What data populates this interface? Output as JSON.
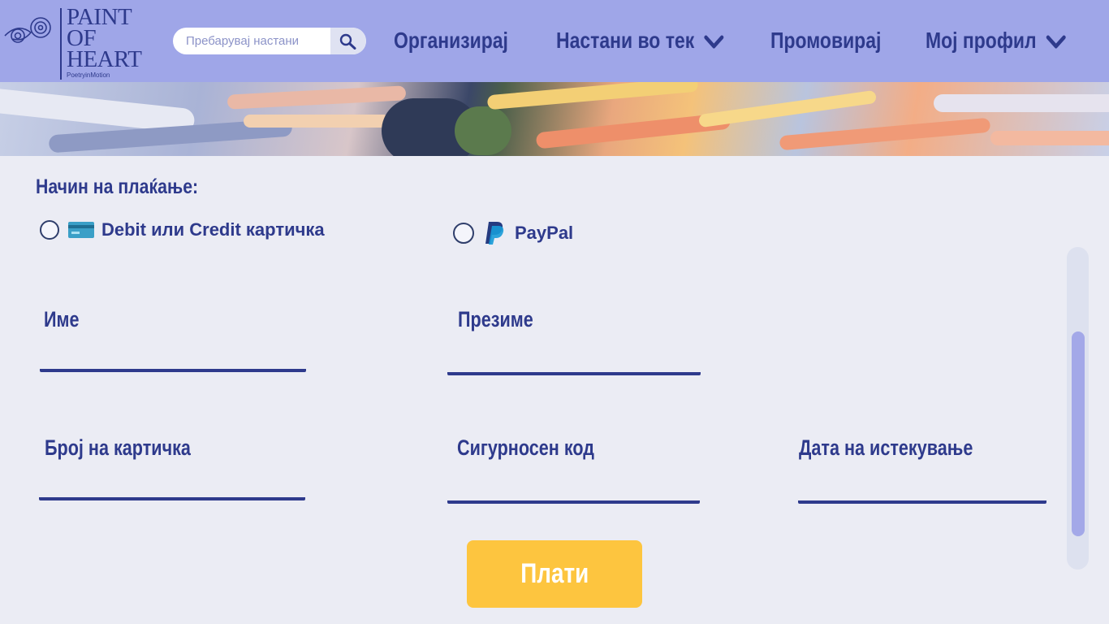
{
  "header": {
    "logo": {
      "line1": "PAINT",
      "line2": "OF",
      "line3": "HEART",
      "tagline": "PoetryinMotion"
    },
    "search": {
      "placeholder": "Пребарувај настани",
      "icon": "search-icon"
    },
    "nav": [
      {
        "label": "Организирај"
      },
      {
        "label": "Настани во тек",
        "icon": "chevron-down-icon"
      },
      {
        "label": "Промовирај"
      },
      {
        "label": "Мој профил",
        "icon": "chevron-down-icon"
      }
    ],
    "colors": {
      "bar": "#9fa6e8",
      "text": "#2e3a8c"
    }
  },
  "form": {
    "heading": "Начин на плаќање:",
    "methods": [
      {
        "label": "Debit или Credit картичка",
        "icon": "credit-card-icon",
        "selected": false
      },
      {
        "label": "PayPal",
        "icon": "paypal-icon",
        "selected": false
      }
    ],
    "fields": {
      "first_name": {
        "label": "Име",
        "value": ""
      },
      "last_name": {
        "label": "Презиме",
        "value": ""
      },
      "card_number": {
        "label": "Број на картичка",
        "value": ""
      },
      "security_code": {
        "label": "Сигурносен код",
        "value": ""
      },
      "expiry_date": {
        "label": "Дата на истекување",
        "value": ""
      }
    },
    "submit_label": "Плати",
    "colors": {
      "button": "#fdc53f",
      "line": "#2e3a8c"
    }
  }
}
